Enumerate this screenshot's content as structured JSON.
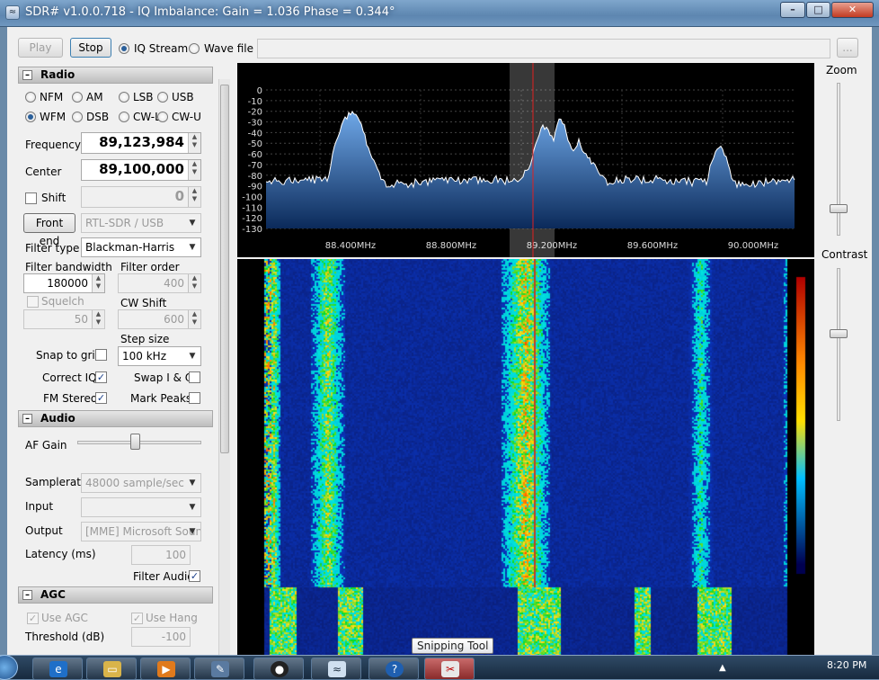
{
  "window": {
    "title": "SDR# v1.0.0.718 - IQ Imbalance: Gain = 1.036 Phase = 0.344°",
    "icon": "sdr-app-icon"
  },
  "toolbar": {
    "play_label": "Play",
    "stop_label": "Stop",
    "source_iq": "IQ Stream",
    "source_wave": "Wave file",
    "browse_label": "..."
  },
  "radio": {
    "header": "Radio",
    "modes": [
      "NFM",
      "AM",
      "LSB",
      "USB",
      "WFM",
      "DSB",
      "CW-L",
      "CW-U"
    ],
    "selected_mode": "WFM",
    "frequency_label": "Frequency",
    "frequency": "89,123,984",
    "center_label": "Center",
    "center": "89,100,000",
    "shift_label": "Shift",
    "shift": "0",
    "frontend_label": "Front end",
    "frontend": "RTL-SDR / USB",
    "filter_type_label": "Filter type",
    "filter_type": "Blackman-Harris",
    "filter_bandwidth_label": "Filter bandwidth",
    "filter_bandwidth": "180000",
    "filter_order_label": "Filter order",
    "filter_order": "400",
    "squelch_label": "Squelch",
    "squelch": "50",
    "cw_shift_label": "CW Shift",
    "cw_shift": "600",
    "step_size_label": "Step size",
    "step_size": "100 kHz",
    "snap_label": "Snap to grid",
    "snap": false,
    "correct_iq_label": "Correct IQ",
    "correct_iq": true,
    "swap_iq_label": "Swap I & Q",
    "swap_iq": false,
    "fm_stereo_label": "FM Stereo",
    "fm_stereo": true,
    "mark_peaks_label": "Mark Peaks",
    "mark_peaks": false
  },
  "audio": {
    "header": "Audio",
    "af_gain_label": "AF Gain",
    "af_gain": 0.45,
    "samplerate_label": "Samplerate",
    "samplerate": "48000 sample/sec",
    "input_label": "Input",
    "input": "",
    "output_label": "Output",
    "output": "[MME] Microsoft Sound",
    "latency_label": "Latency (ms)",
    "latency": "100",
    "filter_audio_label": "Filter Audio",
    "filter_audio": true
  },
  "agc": {
    "header": "AGC",
    "use_agc_label": "Use AGC",
    "use_agc": true,
    "use_hang_label": "Use Hang",
    "use_hang": true,
    "threshold_label": "Threshold (dB)",
    "threshold": "-100"
  },
  "spectrum": {
    "db_ticks": [
      "0",
      "-10",
      "-20",
      "-30",
      "-40",
      "-50",
      "-60",
      "-70",
      "-80",
      "-90",
      "-100",
      "-110",
      "-120",
      "-130"
    ],
    "freq_ticks": [
      "88.400MHz",
      "88.800MHz",
      "89.200MHz",
      "89.600MHz",
      "90.000MHz"
    ],
    "center_freq": "89.1239 MHz"
  },
  "right": {
    "zoom_label": "Zoom",
    "contrast_label": "Contrast",
    "zoom": 0.1,
    "contrast": 0.55
  },
  "taskbar": {
    "items": [
      "start-orb",
      "internet-explorer-icon",
      "file-explorer-icon",
      "media-player-icon",
      "tool-icon",
      "webcam-icon",
      "sdr-app-icon",
      "help-icon",
      "snipping-tool-icon"
    ],
    "clock": "8:20 PM",
    "tooltip": "Snipping Tool"
  },
  "colors": {
    "accent": "#2a5f9a",
    "spectrum_fill": "#3a6fb0",
    "cursor": "#e02020"
  }
}
